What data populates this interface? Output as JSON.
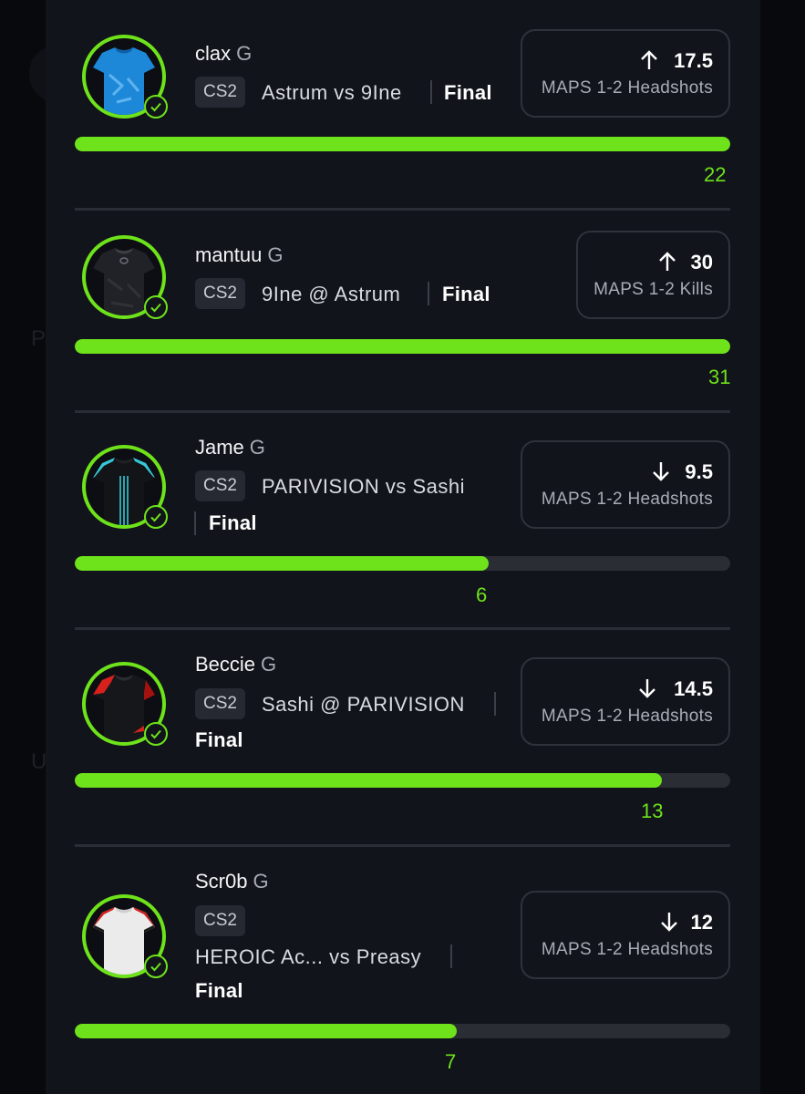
{
  "colors": {
    "accent_green": "#6ee21a",
    "sheet_bg": "#11141b",
    "track_bg": "#2a2d34",
    "card_border": "#2f323a"
  },
  "background_glyphs": [
    "P",
    "U"
  ],
  "picks": [
    {
      "player": "clax",
      "position": "G",
      "game": "CS2",
      "matchup": "Astrum vs 9Ine",
      "status": "Final",
      "direction": "up",
      "direction_icon": "arrow-up-icon",
      "line": "17.5",
      "stat": "MAPS 1-2 Headshots",
      "actual": "22",
      "progress": 1.0,
      "jersey": {
        "body": "#1e88d8",
        "trim": "#0f5fa8",
        "icon": "blue-jersey-icon"
      }
    },
    {
      "player": "mantuu",
      "position": "G",
      "game": "CS2",
      "matchup": "9Ine @ Astrum",
      "status": "Final",
      "direction": "up",
      "direction_icon": "arrow-up-icon",
      "line": "30",
      "stat": "MAPS 1-2 Kills",
      "actual": "31",
      "progress": 1.0,
      "jersey": {
        "body": "#202227",
        "trim": "#3a3d44",
        "icon": "black-jersey-icon"
      }
    },
    {
      "player": "Jame",
      "position": "G",
      "game": "CS2",
      "matchup": "PARIVISION vs Sashi",
      "status": "Final",
      "direction": "down",
      "direction_icon": "arrow-down-icon",
      "line": "9.5",
      "stat": "MAPS 1-2 Headshots",
      "actual": "6",
      "progress": 0.632,
      "jersey": {
        "body": "#121418",
        "trim": "#35c8d6",
        "icon": "black-teal-jersey-icon"
      }
    },
    {
      "player": "Beccie",
      "position": "G",
      "game": "CS2",
      "matchup": "Sashi @ PARIVISION",
      "status": "Final",
      "direction": "down",
      "direction_icon": "arrow-down-icon",
      "line": "14.5",
      "stat": "MAPS 1-2 Headshots",
      "actual": "13",
      "progress": 0.896,
      "jersey": {
        "body": "#16171b",
        "trim": "#d8201c",
        "icon": "black-red-jersey-icon"
      }
    },
    {
      "player": "Scr0b",
      "position": "G",
      "game": "CS2",
      "matchup": "HEROIC Ac... vs Preasy",
      "status": "Final",
      "direction": "down",
      "direction_icon": "arrow-down-icon",
      "line": "12",
      "stat": "MAPS 1-2 Headshots",
      "actual": "7",
      "progress": 0.583,
      "jersey": {
        "body": "#ebebeb",
        "trim": "#d0201d",
        "icon": "white-jersey-icon"
      }
    }
  ]
}
